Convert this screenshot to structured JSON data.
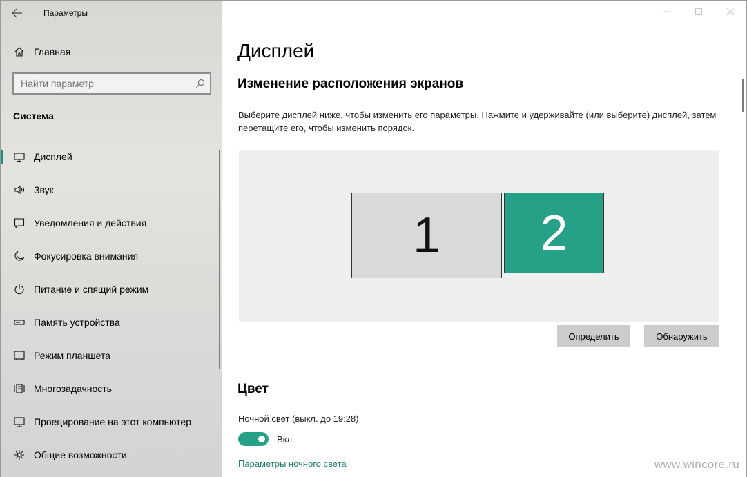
{
  "window": {
    "title": "Параметры",
    "controls": [
      "minimize",
      "maximize",
      "close"
    ]
  },
  "sidebar": {
    "home": {
      "label": "Главная",
      "icon": "home-icon"
    },
    "search": {
      "placeholder": "Найти параметр",
      "icon": "search-icon"
    },
    "section": "Система",
    "items": [
      {
        "label": "Дисплей",
        "icon": "monitor-icon",
        "active": true
      },
      {
        "label": "Звук",
        "icon": "speaker-icon"
      },
      {
        "label": "Уведомления и действия",
        "icon": "message-icon"
      },
      {
        "label": "Фокусировка внимания",
        "icon": "moon-icon"
      },
      {
        "label": "Питание и спящий режим",
        "icon": "power-icon"
      },
      {
        "label": "Память устройства",
        "icon": "storage-icon"
      },
      {
        "label": "Режим планшета",
        "icon": "tablet-icon"
      },
      {
        "label": "Многозадачность",
        "icon": "multitask-icon"
      },
      {
        "label": "Проецирование на этот компьютер",
        "icon": "projector-icon"
      },
      {
        "label": "Общие возможности",
        "icon": "share-icon"
      }
    ]
  },
  "main": {
    "title": "Дисплей",
    "arrange_heading": "Изменение расположения экранов",
    "description": "Выберите дисплей ниже, чтобы изменить его параметры. Нажмите и удерживайте (или выберите) дисплей, затем перетащите его, чтобы изменить порядок.",
    "monitors": [
      {
        "number": "1",
        "selected": false
      },
      {
        "number": "2",
        "selected": true
      }
    ],
    "identify_button": "Определить",
    "detect_button": "Обнаружить",
    "color_heading": "Цвет",
    "night_light_label": "Ночной свет (выкл. до 19:28)",
    "night_light_toggle": {
      "on": true,
      "state_label": "Вкл."
    },
    "night_light_settings_link": "Параметры ночного света"
  },
  "watermark": "www.wincore.ru",
  "colors": {
    "accent": "#26a086",
    "link": "#1a7f69",
    "button": "#cccccc"
  }
}
